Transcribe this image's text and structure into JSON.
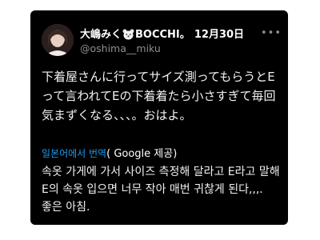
{
  "tweet": {
    "author": {
      "display_name": "大嶋みく",
      "name_suffix": "BOCCHI。",
      "handle": "@oshima__miku"
    },
    "date": "12月30日",
    "text": "下着屋さんに行ってサイズ測ってもらうとEって言われてEの下着着たら小さすぎて毎回気まずくなる、、、。おはよ。"
  },
  "translation": {
    "link_label": "일본어에서 번역",
    "credit": "( Google 제공)",
    "text": "속옷 가게에 가서 사이즈 측정해 달라고 E라고 말해 E의 속옷 입으면 너무 작아 매번 귀찮게 된다,,,. 좋은 아침."
  },
  "icons": {
    "name_emoji": "bear-face-icon",
    "menu": "more-horizontal-icon"
  },
  "colors": {
    "card_background": "#000000",
    "link": "#1d9bf0",
    "secondary_text": "#8b9096"
  }
}
